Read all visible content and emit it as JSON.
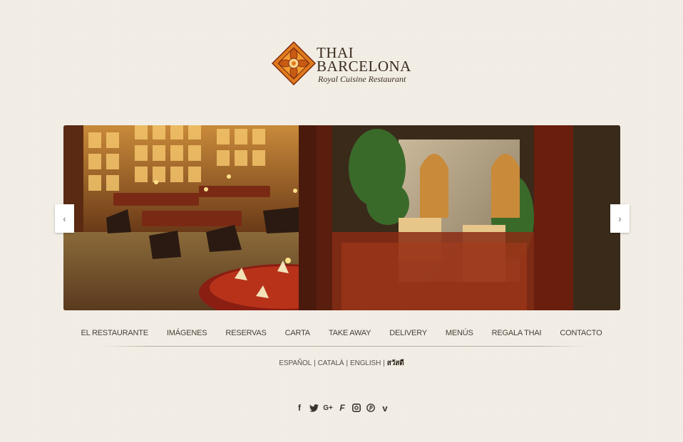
{
  "logo": {
    "line1": "THAI",
    "line2": "BARCELONA",
    "tagline": "Royal Cuisine Restaurant"
  },
  "slider": {
    "prev_glyph": "‹",
    "next_glyph": "›"
  },
  "nav": {
    "items": [
      {
        "label": "EL RESTAURANTE"
      },
      {
        "label": "IMÁGENES"
      },
      {
        "label": "RESERVAS"
      },
      {
        "label": "CARTA"
      },
      {
        "label": "TAKE AWAY"
      },
      {
        "label": "DELIVERY"
      },
      {
        "label": "MENÚS"
      },
      {
        "label": "REGALA THAI"
      },
      {
        "label": "CONTACTO"
      }
    ]
  },
  "languages": {
    "es": "ESPAÑOL",
    "ca": "CATALÀ",
    "en": "ENGLISH",
    "th": "สวัสดี",
    "separator": "|"
  },
  "social": {
    "icons": [
      "facebook-icon",
      "twitter-icon",
      "google-plus-icon",
      "foursquare-icon",
      "instagram-icon",
      "pinterest-icon",
      "vimeo-icon"
    ],
    "glyphs": {
      "facebook": "f",
      "twitter": "t",
      "google": "G+",
      "foursquare": "F",
      "instagram": "◙",
      "pinterest": "℗",
      "vimeo": "v"
    }
  },
  "colors": {
    "accent": "#e07a1e",
    "text": "#4a4038",
    "background": "#f3efe7"
  }
}
